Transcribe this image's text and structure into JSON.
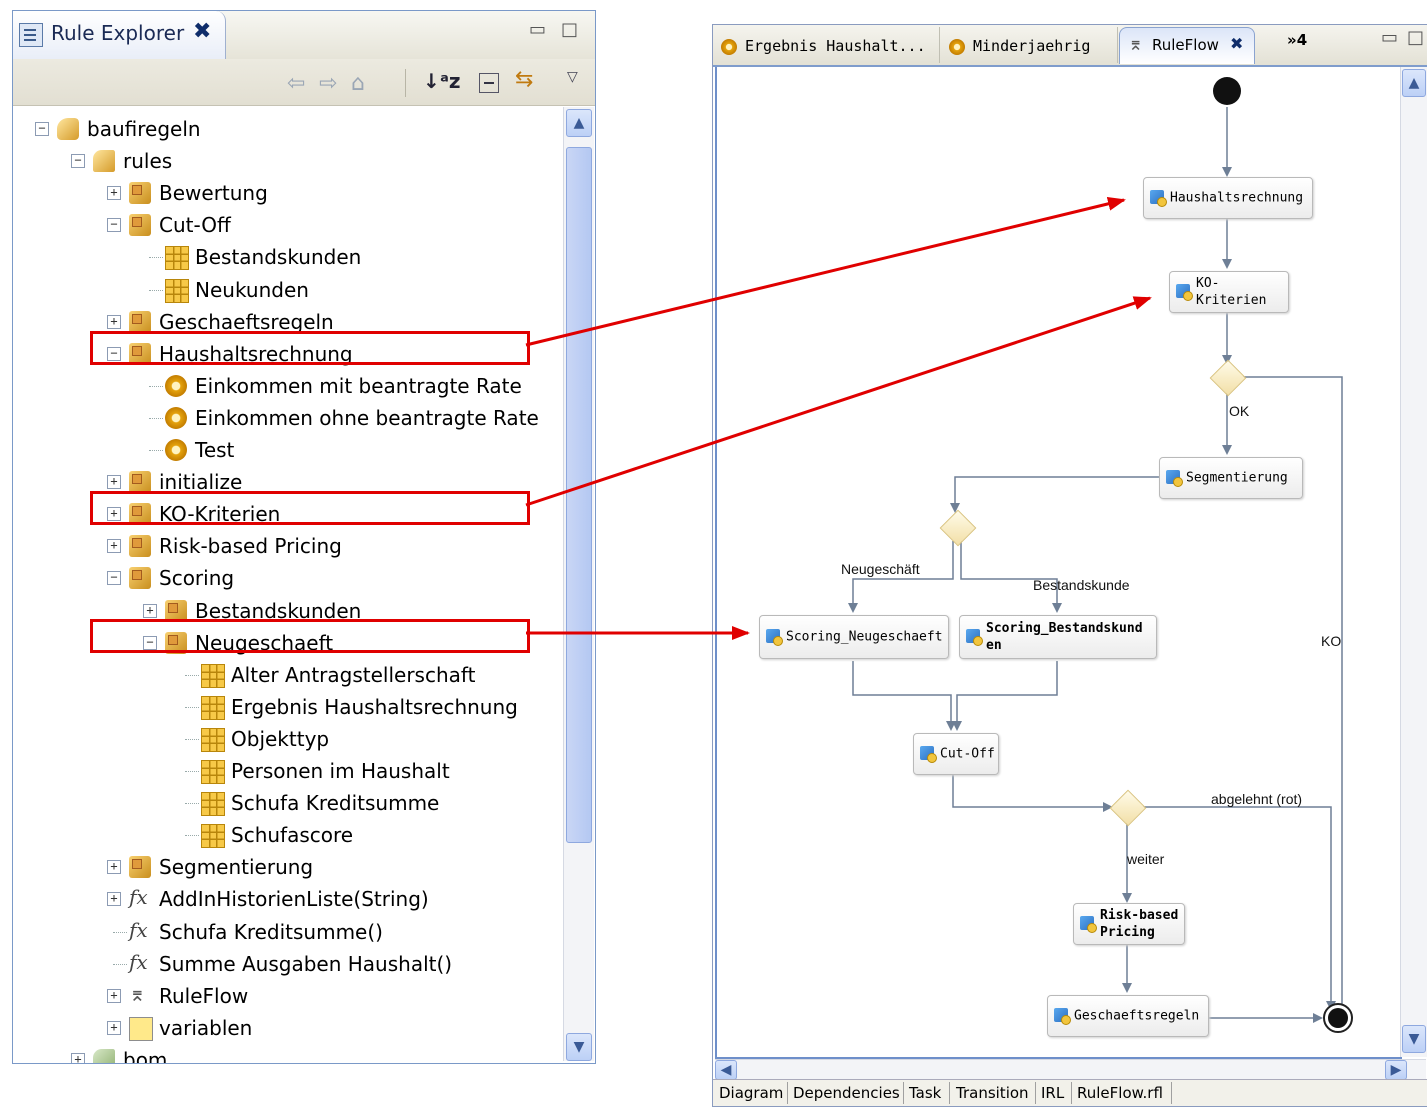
{
  "explorer": {
    "title": "Rule Explorer",
    "close_glyph": "✖",
    "minimize_glyph": "▭",
    "maximize_glyph": "□",
    "toolbar_icons": [
      "back-arrow-icon",
      "forward-arrow-icon",
      "up-folder-icon",
      "sort-alpha-icon",
      "collapse-all-icon",
      "link-editor-icon",
      "view-menu-icon"
    ],
    "tree": [
      {
        "label": "baufiregeln",
        "icon": "project-icon",
        "expander": "minus"
      },
      {
        "label": "rules",
        "icon": "rules-folder-icon",
        "expander": "minus"
      },
      {
        "label": "Bewertung",
        "icon": "package-icon",
        "expander": "plus"
      },
      {
        "label": "Cut-Off",
        "icon": "package-icon",
        "expander": "minus"
      },
      {
        "label": "Bestandskunden",
        "icon": "decision-table-icon",
        "expander": ""
      },
      {
        "label": "Neukunden",
        "icon": "decision-table-icon",
        "expander": ""
      },
      {
        "label": "Geschaeftsregeln",
        "icon": "package-icon",
        "expander": "plus"
      },
      {
        "label": "Haushaltsrechnung",
        "icon": "package-icon",
        "expander": "minus"
      },
      {
        "label": "Einkommen mit beantragte Rate",
        "icon": "rule-gear-icon",
        "expander": ""
      },
      {
        "label": "Einkommen ohne beantragte Rate",
        "icon": "rule-gear-icon",
        "expander": ""
      },
      {
        "label": "Test",
        "icon": "rule-gear-icon",
        "expander": ""
      },
      {
        "label": "initialize",
        "icon": "package-icon",
        "expander": "plus"
      },
      {
        "label": "KO-Kriterien",
        "icon": "package-icon",
        "expander": "plus"
      },
      {
        "label": "Risk-based Pricing",
        "icon": "package-icon",
        "expander": "plus"
      },
      {
        "label": "Scoring",
        "icon": "package-icon",
        "expander": "minus"
      },
      {
        "label": "Bestandskunden",
        "icon": "package-icon",
        "expander": "plus"
      },
      {
        "label": "Neugeschaeft",
        "icon": "package-icon",
        "expander": "minus"
      },
      {
        "label": "Alter Antragstellerschaft",
        "icon": "decision-table-icon",
        "expander": ""
      },
      {
        "label": "Ergebnis Haushaltsrechnung",
        "icon": "decision-table-icon",
        "expander": ""
      },
      {
        "label": "Objekttyp",
        "icon": "decision-table-icon",
        "expander": ""
      },
      {
        "label": "Personen im Haushalt",
        "icon": "decision-table-icon",
        "expander": ""
      },
      {
        "label": "Schufa Kreditsumme",
        "icon": "decision-table-icon",
        "expander": ""
      },
      {
        "label": "Schufascore",
        "icon": "decision-table-icon",
        "expander": ""
      },
      {
        "label": "Segmentierung",
        "icon": "package-icon",
        "expander": "plus"
      },
      {
        "label": "AddInHistorienListe(String)",
        "icon": "function-fx-icon",
        "expander": "plus"
      },
      {
        "label": "Schufa Kreditsumme()",
        "icon": "function-fx-icon",
        "expander": ""
      },
      {
        "label": "Summe Ausgaben Haushalt()",
        "icon": "function-fx-icon",
        "expander": ""
      },
      {
        "label": "RuleFlow",
        "icon": "ruleflow-icon",
        "expander": "plus"
      },
      {
        "label": "variablen",
        "icon": "variables-icon",
        "expander": "plus"
      },
      {
        "label": "bom",
        "icon": "bom-icon",
        "expander": "plus"
      }
    ]
  },
  "editor": {
    "tabs": [
      {
        "label": "Ergebnis Haushalt...",
        "icon": "rule-gear-icon"
      },
      {
        "label": "Minderjaehrig",
        "icon": "rule-gear-icon"
      },
      {
        "label": "RuleFlow",
        "icon": "ruleflow-icon",
        "active": true
      }
    ],
    "overflow_tabs": "»4",
    "close_glyph": "✖",
    "bottom_tabs": [
      "Diagram",
      "Dependencies",
      "Task",
      "Transition",
      "IRL",
      "RuleFlow.rfl"
    ],
    "flow": {
      "nodes": {
        "haushaltsrechnung": "Haushaltsrechnung",
        "ko_kriterien": "KO-Kriterien",
        "segmentierung": "Segmentierung",
        "scoring_neugeschaeft": "Scoring_Neugeschaeft",
        "scoring_bestandskunden": "Scoring_Bestandskund\nen",
        "cut_off": "Cut-Off",
        "risk_based_pricing": "Risk-based\nPricing",
        "geschaeftsregeln": "Geschaeftsregeln"
      },
      "edge_labels": {
        "ok": "OK",
        "ko": "KO",
        "neugeschaeft": "Neugeschäft",
        "bestandskunde": "Bestandskunde",
        "abgelehnt": "abgelehnt (rot)",
        "weiter": "weiter"
      }
    }
  },
  "colors": {
    "highlight": "#e00000",
    "arrow": "#e00000",
    "flow_line": "#6e7f96"
  }
}
